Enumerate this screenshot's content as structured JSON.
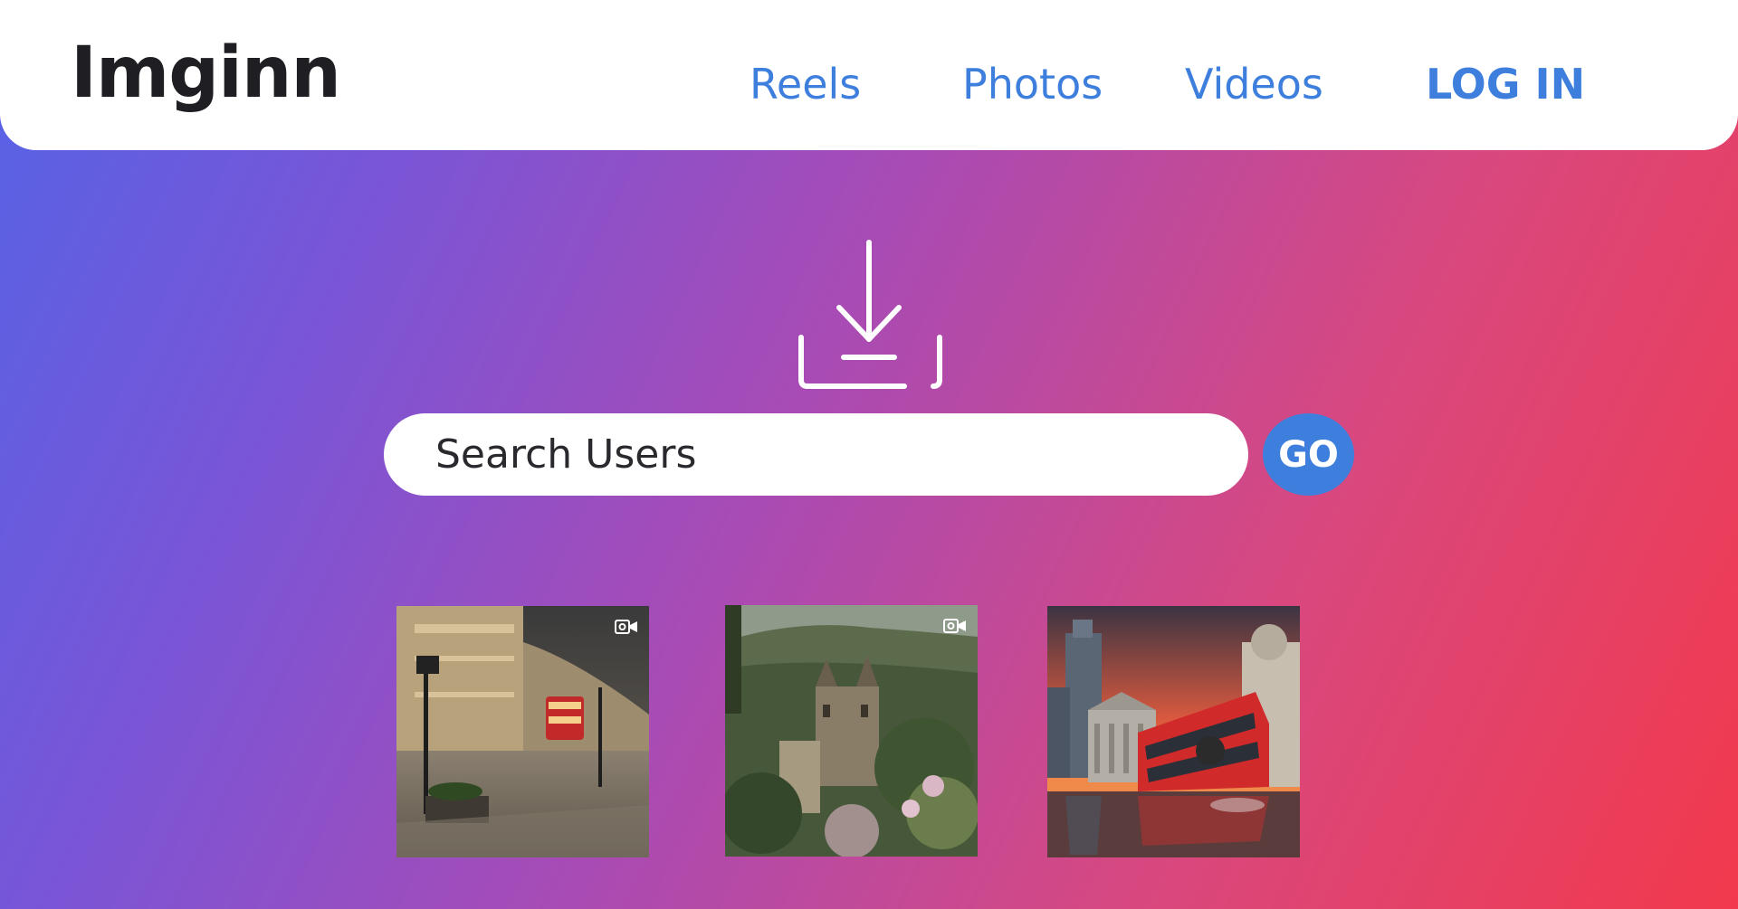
{
  "header": {
    "logo": "Imginn",
    "nav": [
      {
        "label": "Reels"
      },
      {
        "label": "Photos"
      },
      {
        "label": "Videos"
      }
    ],
    "login_label": "LOG IN"
  },
  "search": {
    "placeholder": "Search Users",
    "go_label": "GO"
  },
  "thumbnails": [
    {
      "icon": "video-camera-icon"
    },
    {
      "icon": "video-camera-icon"
    },
    {
      "icon": null
    }
  ],
  "colors": {
    "accent": "#3e7fde",
    "logo": "#1f1f23",
    "gradient_start": "#5563e6",
    "gradient_end": "#f2394c"
  }
}
